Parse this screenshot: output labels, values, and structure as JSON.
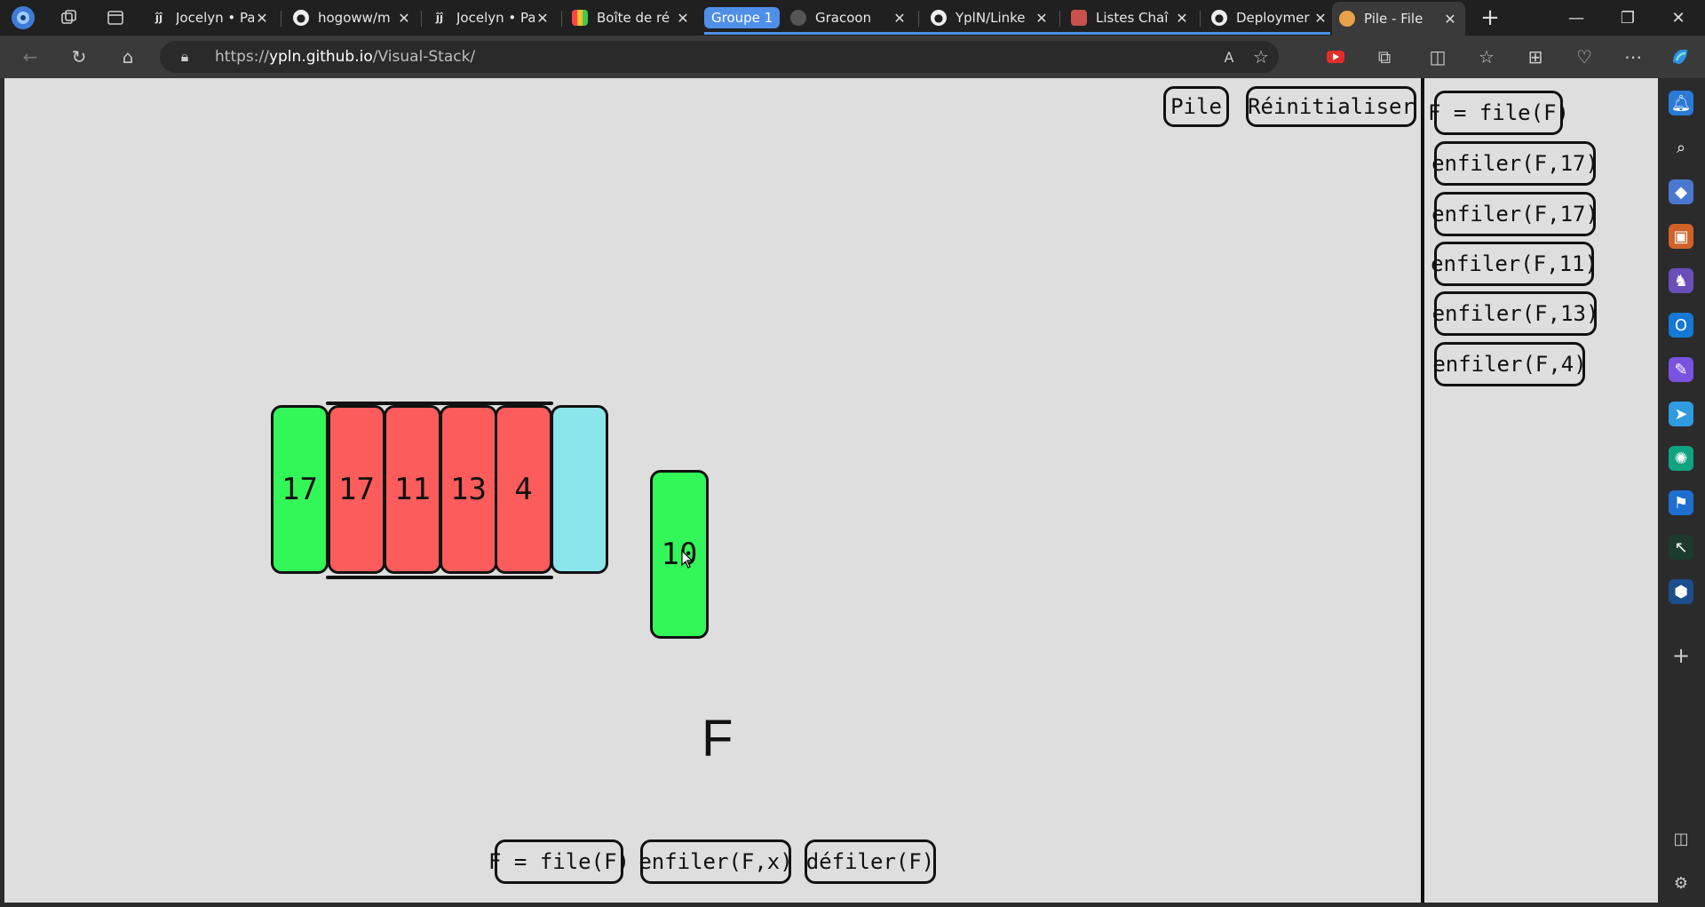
{
  "browser": {
    "tabs": [
      {
        "title": "Jocelyn • Pa",
        "icon": "jj-icon"
      },
      {
        "title": "hogoww/m",
        "icon": "github-icon"
      },
      {
        "title": "Jocelyn • Pa",
        "icon": "jj-icon"
      },
      {
        "title": "Boîte de ré",
        "icon": "forms-icon"
      },
      {
        "title": "Gracoon",
        "icon": "raccoon-icon"
      },
      {
        "title": "YplN/Linke",
        "icon": "github-icon"
      },
      {
        "title": "Listes Chaî",
        "icon": "slides-icon"
      },
      {
        "title": "Deploymer",
        "icon": "github-icon"
      },
      {
        "title": "Pile - File",
        "icon": "pancake-icon",
        "active": true
      }
    ],
    "tab_group_label": "Groupe 1",
    "url_prefix": "https://",
    "url_host": "ypln.github.io",
    "url_path": "/Visual-Stack/"
  },
  "app": {
    "top_buttons": {
      "pile": "Pile",
      "reset": "Réinitialiser"
    },
    "queue": {
      "name": "F",
      "cells": [
        {
          "value": "17",
          "color": "green"
        },
        {
          "value": "17",
          "color": "red"
        },
        {
          "value": "11",
          "color": "red"
        },
        {
          "value": "13",
          "color": "red"
        },
        {
          "value": "4",
          "color": "red"
        },
        {
          "value": "",
          "color": "cyan"
        }
      ],
      "floating_value": "10"
    },
    "history": [
      "F = file(F)",
      "enfiler(F,17)",
      "enfiler(F,17)",
      "enfiler(F,11)",
      "enfiler(F,13)",
      "enfiler(F,4)"
    ],
    "bottom_buttons": {
      "create": "F = file(F)",
      "enqueue": "enfiler(F,x)",
      "dequeue": "défiler(F)"
    }
  },
  "colors": {
    "green": "#33f758",
    "red": "#fd5c5c",
    "cyan": "#8ae6ea",
    "background": "#dedede",
    "accent": "#4f8fe8"
  }
}
